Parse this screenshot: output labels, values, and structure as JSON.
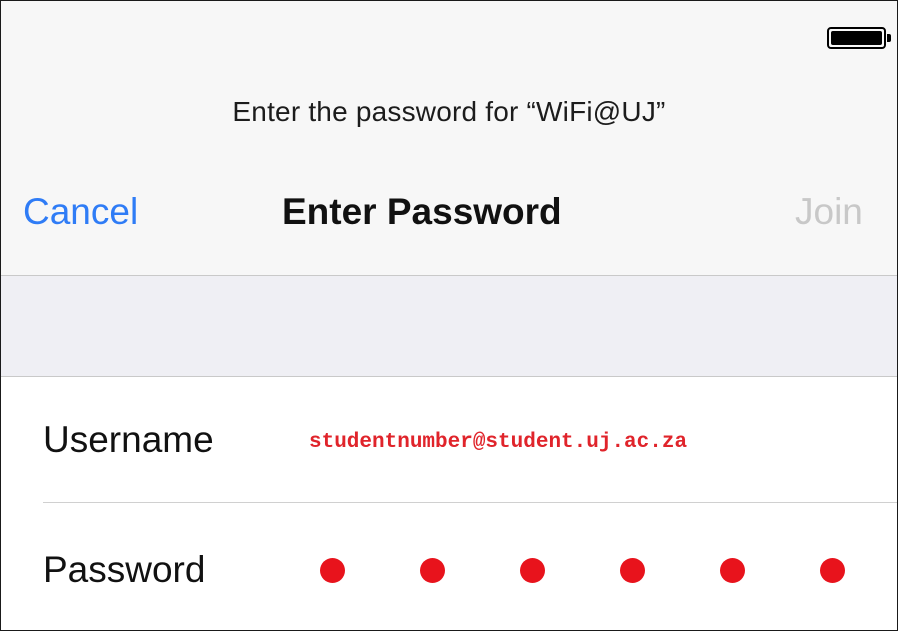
{
  "prompt": "Enter the password for “WiFi@UJ”",
  "nav": {
    "cancel_label": "Cancel",
    "title": "Enter Password",
    "join_label": "Join"
  },
  "form": {
    "username": {
      "label": "Username",
      "value": "studentnumber@student.uj.ac.za"
    },
    "password": {
      "label": "Password",
      "masked_char_count": 6
    }
  },
  "colors": {
    "accent": "#2f7cf6",
    "disabled": "#c8c8c8",
    "annotation_red": "#e0242b"
  },
  "icons": {
    "battery": "battery-full-icon"
  }
}
